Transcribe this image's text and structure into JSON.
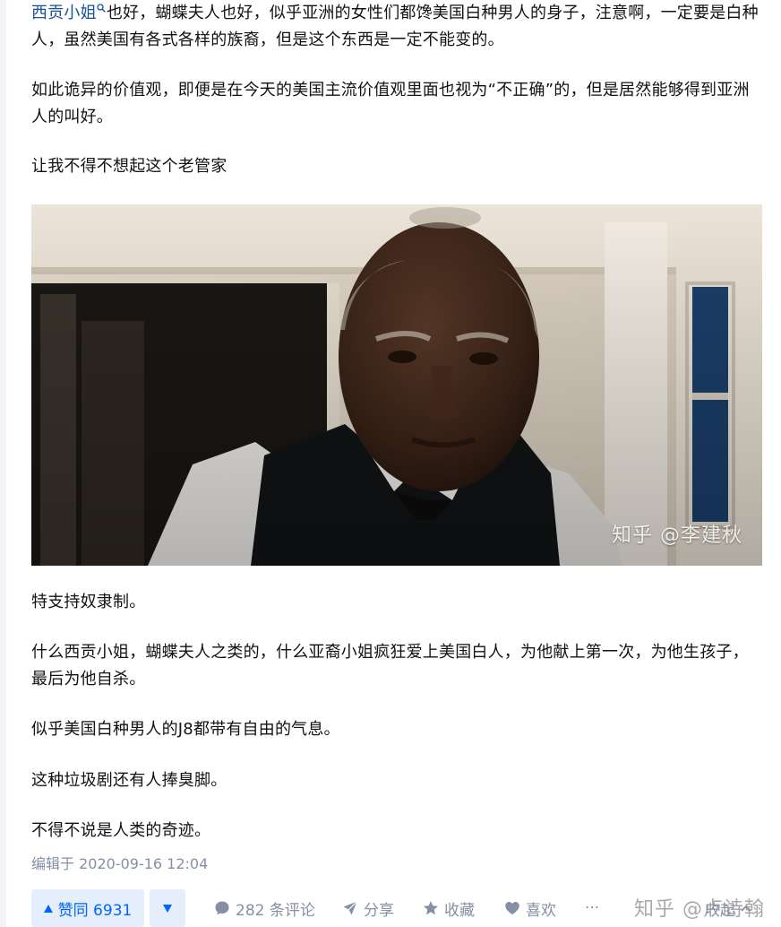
{
  "article": {
    "p1": {
      "link": "西贡小姐",
      "text": "也好，蝴蝶夫人也好，似乎亚洲的女性们都馋美国白种男人的身子，注意啊，一定要是白种人，虽然美国有各式各样的族裔，但是这个东西是一定不能变的。"
    },
    "p2": "如此诡异的价值观，即便是在今天的美国主流价值观里面也视为“不正确”的，但是居然能够得到亚洲人的叫好。",
    "p3": "让我不得不想起这个老管家",
    "image_watermark": "知乎 @李建秋",
    "p4": "特支持奴隶制。",
    "p5": "什么西贡小姐，蝴蝶夫人之类的，什么亚裔小姐疯狂爱上美国白人，为他献上第一次，为他生孩子，最后为他自杀。",
    "p6": "似乎美国白种男人的J8都带有自由的气息。",
    "p7": "这种垃圾剧还有人捧臭脚。",
    "p8": "不得不说是人类的奇迹。",
    "edit_time": "编辑于 2020-09-16 12:04"
  },
  "actions": {
    "upvote": "赞同 6931",
    "comments": "282 条评论",
    "share": "分享",
    "collect": "收藏",
    "like": "喜欢",
    "more": "···",
    "collapse": "收起"
  },
  "page_watermark": "知乎 @卢诗翰",
  "colors": {
    "link": "#175199",
    "accent": "#0066ff",
    "vote_bg": "#e5eefb",
    "meta": "#8590a6"
  }
}
